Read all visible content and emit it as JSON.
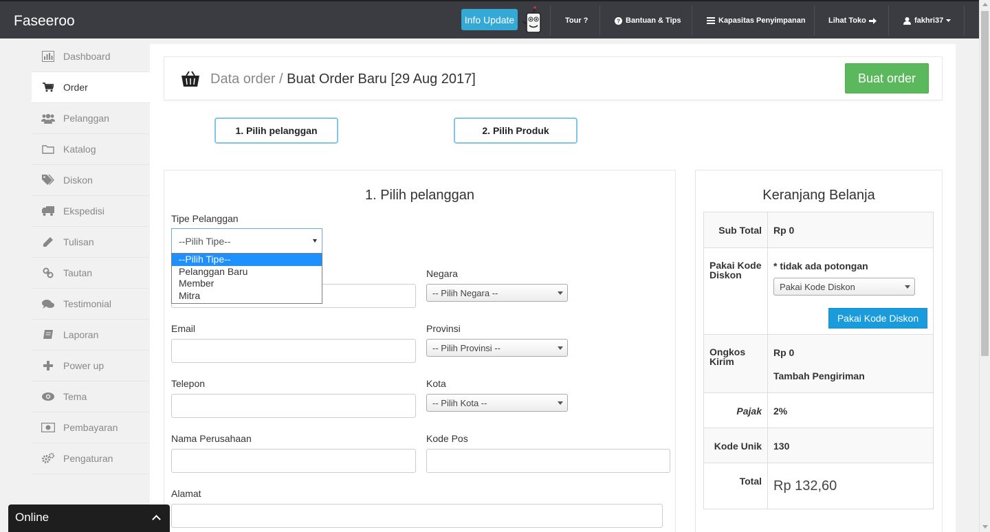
{
  "topbar": {
    "brand": "Faseeroo",
    "info_update": "Info Update",
    "nav": {
      "tour": "Tour ?",
      "bantuan": "Bantuan & Tips",
      "kapasitas": "Kapasitas Penyimpanan",
      "lihat_toko": "Lihat Toko",
      "user": "fakhri37"
    }
  },
  "sidebar": {
    "items": [
      {
        "label": "Dashboard",
        "icon": "bar-chart-icon"
      },
      {
        "label": "Order",
        "icon": "cart-icon"
      },
      {
        "label": "Pelanggan",
        "icon": "users-icon"
      },
      {
        "label": "Katalog",
        "icon": "folder-icon"
      },
      {
        "label": "Diskon",
        "icon": "tags-icon"
      },
      {
        "label": "Ekspedisi",
        "icon": "truck-icon"
      },
      {
        "label": "Tulisan",
        "icon": "pencil-icon"
      },
      {
        "label": "Tautan",
        "icon": "link-icon"
      },
      {
        "label": "Testimonial",
        "icon": "comments-icon"
      },
      {
        "label": "Laporan",
        "icon": "book-icon"
      },
      {
        "label": "Power up",
        "icon": "plus-icon"
      },
      {
        "label": "Tema",
        "icon": "eye-icon"
      },
      {
        "label": "Pembayaran",
        "icon": "money-icon"
      },
      {
        "label": "Pengaturan",
        "icon": "cogs-icon"
      }
    ],
    "active_index": 1
  },
  "header": {
    "breadcrumb_parent": "Data order /",
    "title": "Buat Order Baru [29 Aug 2017]",
    "buat_order": "Buat order"
  },
  "steps": {
    "step1": "1. Pilih pelanggan",
    "step2": "2. Pilih Produk"
  },
  "form": {
    "title": "1. Pilih pelanggan",
    "tipe_label": "Tipe Pelanggan",
    "tipe_value": "--Pilih Tipe--",
    "tipe_options": [
      "--Pilih Tipe--",
      "Pelanggan Baru",
      "Member",
      "Mitra"
    ],
    "negara_label": "Negara",
    "negara_value": "-- Pilih Negara --",
    "email_label": "Email",
    "provinsi_label": "Provinsi",
    "provinsi_value": "-- Pilih Provinsi --",
    "telepon_label": "Telepon",
    "kota_label": "Kota",
    "kota_value": "-- Pilih Kota --",
    "perusahaan_label": "Nama Perusahaan",
    "kodepos_label": "Kode Pos",
    "alamat_label": "Alamat"
  },
  "cart": {
    "title": "Keranjang Belanja",
    "subtotal_label": "Sub Total",
    "subtotal_value": "Rp 0",
    "kode_label": "Pakai Kode Diskon",
    "kode_note": "* tidak ada potongan",
    "kode_select": "Pakai Kode Diskon",
    "kode_button": "Pakai Kode Diskon",
    "ongkos_label": "Ongkos Kirim",
    "ongkos_value": "Rp 0",
    "tambah_pengiriman": "Tambah Pengiriman",
    "pajak_label": "Pajak",
    "pajak_value": "2%",
    "kode_unik_label": "Kode Unik",
    "kode_unik_value": "130",
    "total_label": "Total",
    "total_value": "Rp 132,60"
  },
  "chat": {
    "status": "Online"
  },
  "colors": {
    "topbar": "#3a3c41",
    "info_update": "#35a9d6",
    "success": "#5cb85c",
    "primary": "#1a9bdc",
    "step_border": "#7fc6e1"
  }
}
